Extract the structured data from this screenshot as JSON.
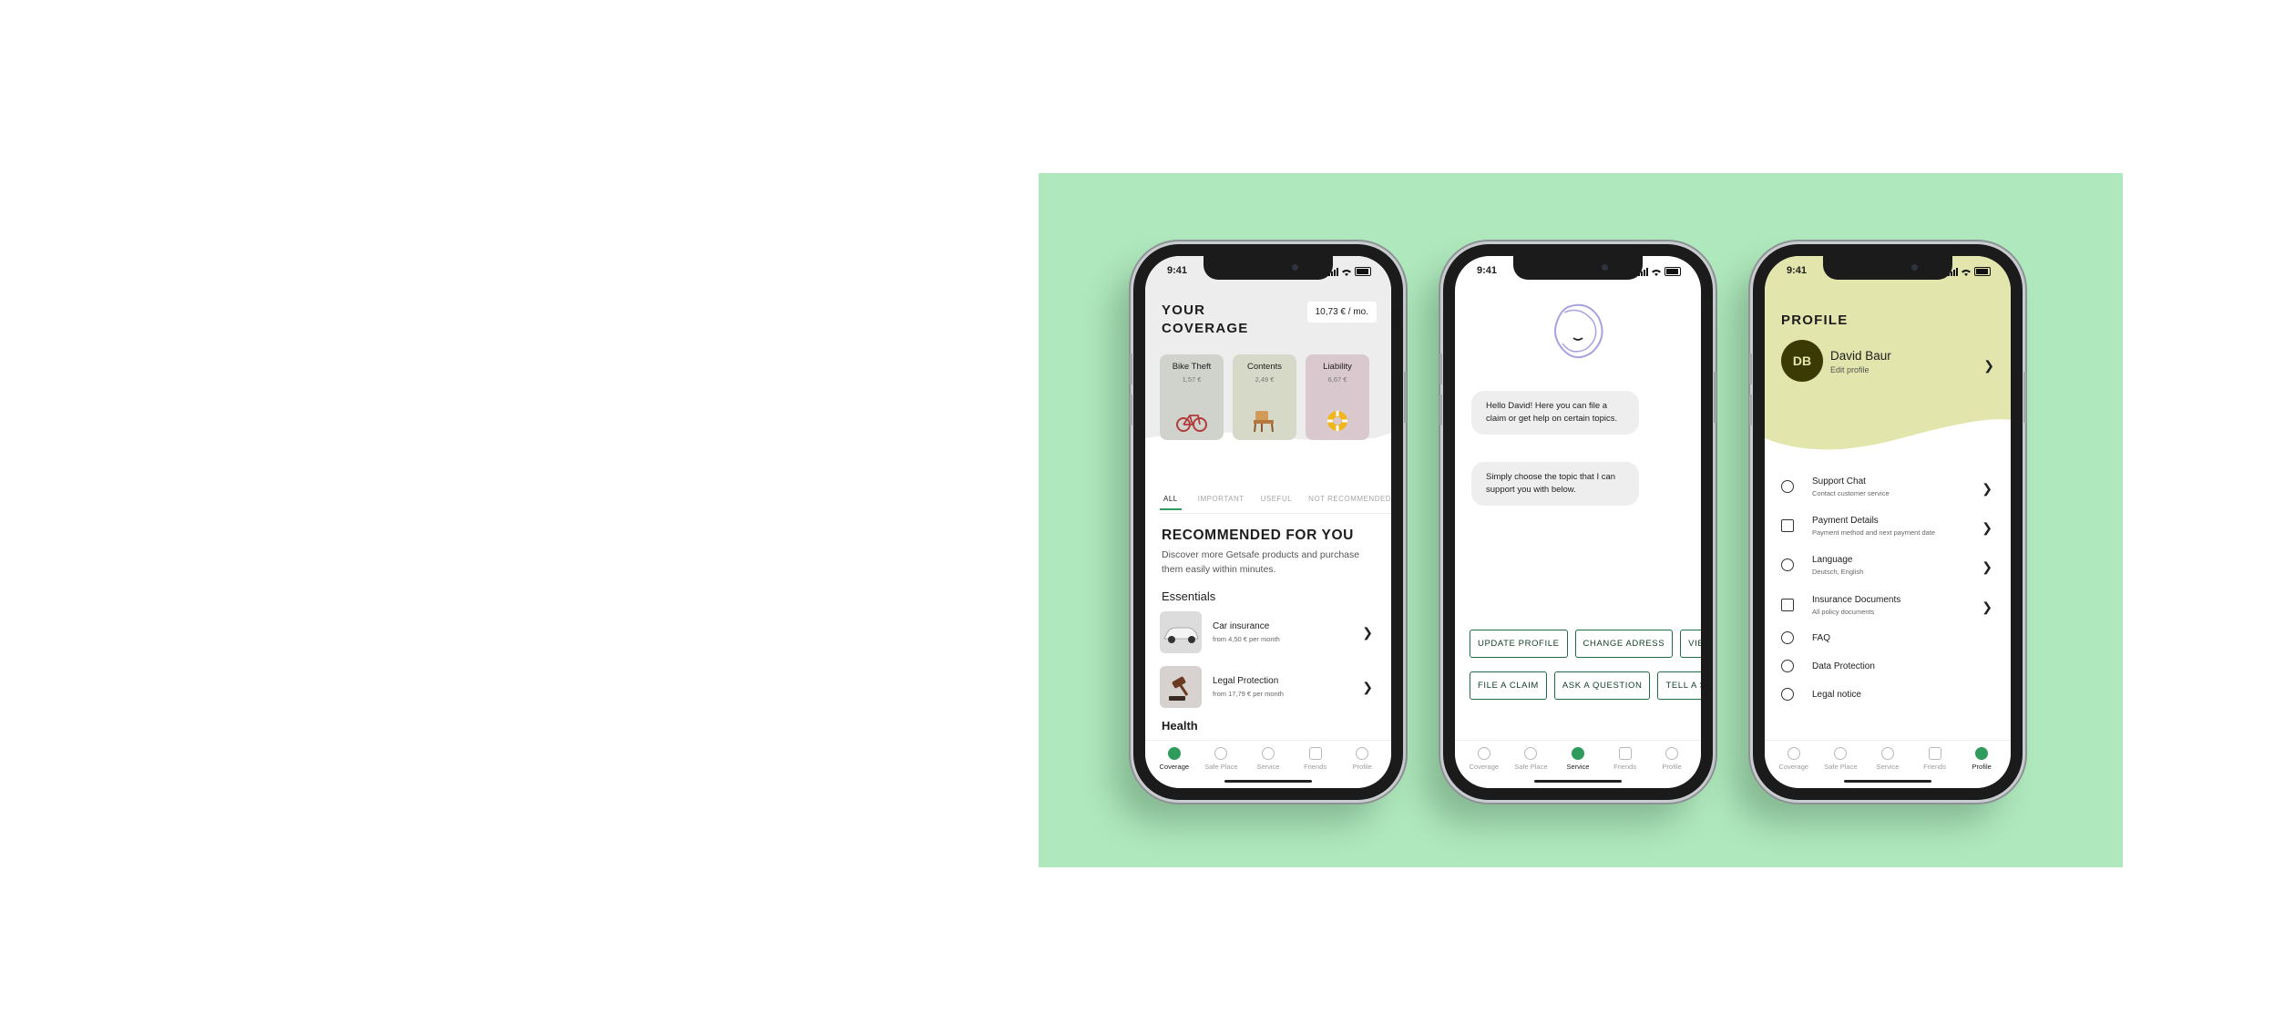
{
  "status_time": "9:41",
  "phones": {
    "coverage": {
      "title": "YOUR COVERAGE",
      "monthly_total": "10,73 € / mo.",
      "cards": [
        {
          "name": "Bike Theft",
          "price": "1,57 €",
          "color": "#cfd3cc"
        },
        {
          "name": "Contents",
          "price": "2,49 €",
          "color": "#d6d8c8"
        },
        {
          "name": "Liability",
          "price": "6,67 €",
          "color": "#d9c9cf"
        }
      ],
      "filter_tabs": [
        "ALL",
        "IMPORTANT",
        "USEFUL",
        "NOT RECOMMENDED"
      ],
      "recommended_title": "RECOMMENDED FOR YOU",
      "recommended_sub": "Discover more Getsafe products and purchase them easily within minutes.",
      "section_essentials": "Essentials",
      "products": [
        {
          "name": "Car insurance",
          "desc": "from 4,50 € per month"
        },
        {
          "name": "Legal Protection",
          "desc": "from 17,79 € per month"
        }
      ],
      "section_health": "Health"
    },
    "service": {
      "messages": [
        "Hello David! Here you can file a claim or get help on certain topics.",
        "Simply choose the topic that I can support you with below."
      ],
      "chips_row1": [
        "UPDATE PROFILE",
        "CHANGE ADRESS",
        "VIEW"
      ],
      "chips_row2": [
        "FILE A CLAIM",
        "ASK A QUESTION",
        "TELL A STORY"
      ]
    },
    "profile": {
      "title": "PROFILE",
      "initials": "DB",
      "name": "David Baur",
      "edit": "Edit profile",
      "menu": [
        {
          "title": "Support Chat",
          "sub": "Contact customer service",
          "icon": "help-circle-icon"
        },
        {
          "title": "Payment Details",
          "sub": "Payment method and next payment date",
          "icon": "receipt-icon"
        },
        {
          "title": "Language",
          "sub": "Deutsch, English",
          "icon": "globe-icon"
        },
        {
          "title": "Insurance Documents",
          "sub": "All policy documents",
          "icon": "document-icon"
        },
        {
          "title": "FAQ",
          "sub": "",
          "icon": "question-icon"
        },
        {
          "title": "Data Protection",
          "sub": "",
          "icon": "shield-icon"
        },
        {
          "title": "Legal notice",
          "sub": "",
          "icon": "info-icon"
        }
      ]
    }
  },
  "tabbar": [
    "Coverage",
    "Safe Place",
    "Service",
    "Friends",
    "Profile"
  ],
  "colors": {
    "background": "#b0e8bd",
    "accent": "#2f9b5c",
    "profile_header": "#e3e6ac",
    "avatar": "#3b3a05"
  }
}
